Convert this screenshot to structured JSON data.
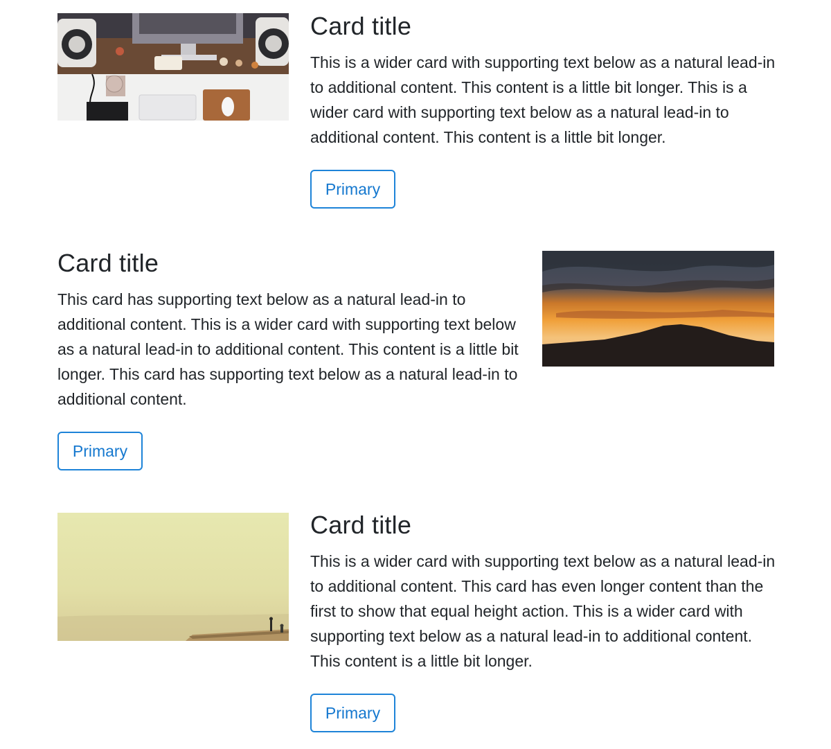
{
  "cards": [
    {
      "title": "Card title",
      "text": "This is a wider card with supporting text below as a natural lead-in to additional content. This content is a little bit longer. This is a wider card with supporting text below as a natural lead-in to additional content. This content is a little bit longer.",
      "button_label": "Primary",
      "image": "desk-workspace-photo"
    },
    {
      "title": "Card title",
      "text": "This card has supporting text below as a natural lead-in to additional content. This is a wider card with supporting text below as a natural lead-in to additional content. This content is a little bit longer. This card has supporting text below as a natural lead-in to additional content.",
      "button_label": "Primary",
      "image": "sunset-hill-photo"
    },
    {
      "title": "Card title",
      "text": "This is a wider card with supporting text below as a natural lead-in to additional content. This card has even longer content than the first to show that equal height action. This is a wider card with supporting text below as a natural lead-in to additional content. This content is a little bit longer.",
      "button_label": "Primary",
      "image": "hazy-cliff-photo"
    }
  ],
  "colors": {
    "button_border": "#1d83d8",
    "button_text": "#1578cf",
    "text": "#212529"
  }
}
